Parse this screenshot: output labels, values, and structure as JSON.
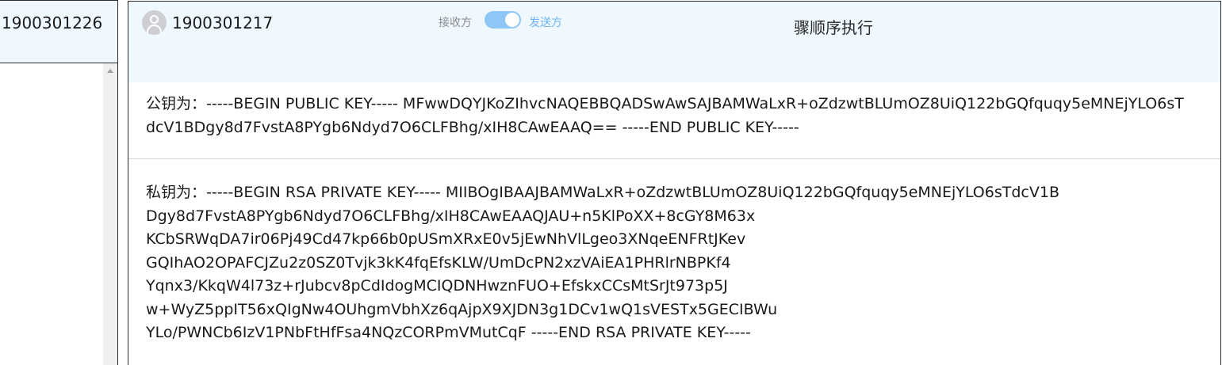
{
  "left_panel": {
    "contact_id": "1900301226"
  },
  "header": {
    "contact_id": "1900301217",
    "receiver_label": "接收方",
    "sender_label": "发送方",
    "toggle_state": "sender",
    "step_text": "骤顺序执行"
  },
  "public_key": {
    "text": "公钥为：-----BEGIN PUBLIC KEY----- MFwwDQYJKoZIhvcNAQEBBQADSwAwSAJBAMWaLxR+oZdzwtBLUmOZ8UiQ122bGQfquqy5eMNEjYLO6sTdcV1BDgy8d7FvstA8PYgb6Ndyd7O6CLFBhg/xIH8CAwEAAQ== -----END PUBLIC KEY-----"
  },
  "private_key": {
    "lines": [
      "私钥为：-----BEGIN RSA PRIVATE KEY----- MIIBOgIBAAJBAMWaLxR+oZdzwtBLUmOZ8UiQ122bGQfquqy5eMNEjYLO6sTdcV1B",
      "Dgy8d7FvstA8PYgb6Ndyd7O6CLFBhg/xIH8CAwEAAQJAU+n5KlPoXX+8cGY8M63x",
      "KCbSRWqDA7ir06Pj49Cd47kp66b0pUSmXRxE0v5jEwNhVlLgeo3XNqeENFRtJKev",
      "GQIhAO2OPAFCJZu2z0SZ0Tvjk3kK4fqEfsKLW/UmDcPN2xzVAiEA1PHRlrNBPKf4",
      "Yqnx3/KkqW4l73z+rJubcv8pCdIdogMCIQDNHwznFUO+EfskxCCsMtSrJt973p5J",
      "w+WyZ5ppIT56xQIgNw4OUhgmVbhXz6qAjpX9XJDN3g1DCv1wQ1sVESTx5GECIBWu",
      "YLo/PWNCb6IzV1PNbFtHfFsa4NQzCORPmVMutCqF -----END RSA PRIVATE KEY-----"
    ]
  },
  "icons": {
    "avatar": "user-avatar-icon",
    "scroll_up": "scroll-up-arrow-icon"
  },
  "colors": {
    "header_bg": "#f0f8ff",
    "toggle_on": "#8ec6f5",
    "sender_label": "#6cb3ef",
    "receiver_label": "#8a8a8a"
  }
}
